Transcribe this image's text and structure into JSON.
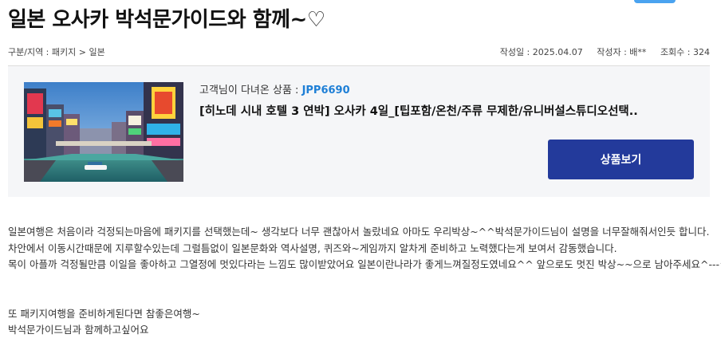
{
  "post": {
    "title": "일본 오사카 박석문가이드와 함께~♡",
    "breadcrumb": "구분/지역 : 패키지 > 일본",
    "date": "작성일 : 2025.04.07",
    "author": "작성자 : 배**",
    "views": "조회수 : 324"
  },
  "product": {
    "label_prefix": "고객님이 다녀온 상품 : ",
    "code": "JPP6690",
    "name": "[히노데 시내 호텔 3 연박] 오사카 4일_[팁포함/온천/주류 무제한/유니버설스튜디오선택..",
    "button_label": "상품보기"
  },
  "review": {
    "lines": [
      "일본여행은 처음이라 걱정되는마음에 패키지를 선택했는데~  생각보다 너무 괜찮아서 놀랐네요 아마도 우리박상~^^박석문가이드님이 설명을 너무잘해줘서인듯 합니다.",
      "차안에서 이동시간때문에 지루할수있는데 그럴틈없이 일본문화와 역사설명, 퀴즈와~게임까지 알차게 준비하고 노력했다는게 보여서 감동했습니다.",
      "목이 아플까 걱정될만큼 이일을 좋아하고 그열정에 멋있다라는 느낌도 많이받았어요 일본이란나라가 좋게느껴질정도였네요^^ 앞으로도 멋진 박상~~으로 남아주세요^---^",
      "또 패키지여행을 준비하게된다면 참좋은여행~",
      "박석문가이드님과 함께하고싶어요"
    ]
  },
  "colors": {
    "button_bg": "#233a9b",
    "code_color": "#1e7fd6",
    "box_bg": "#f5f6f8"
  }
}
